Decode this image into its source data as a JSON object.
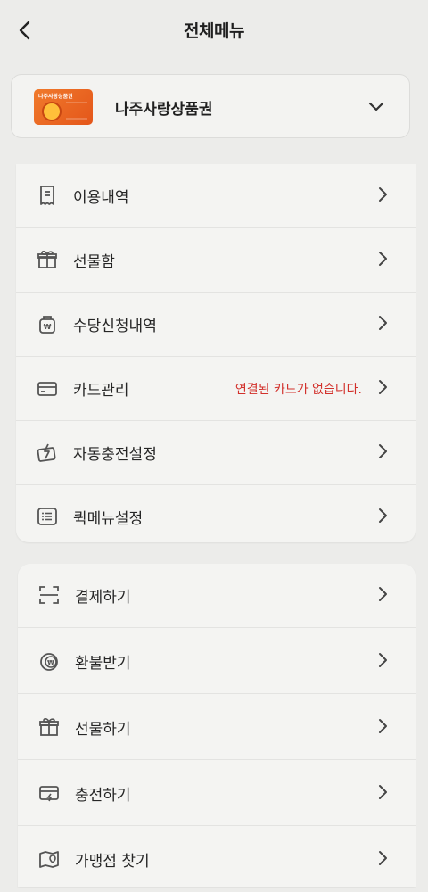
{
  "header": {
    "title": "전체메뉴"
  },
  "voucher": {
    "name": "나주사랑상품권",
    "image_text": "나주사랑상품권"
  },
  "menu_group_1": [
    {
      "label": "이용내역",
      "icon": "receipt-icon"
    },
    {
      "label": "선물함",
      "icon": "gift-box-icon"
    },
    {
      "label": "수당신청내역",
      "icon": "won-bag-icon"
    },
    {
      "label": "카드관리",
      "icon": "card-icon",
      "note": "연결된 카드가 없습니다."
    },
    {
      "label": "자동충전설정",
      "icon": "auto-charge-icon"
    },
    {
      "label": "퀵메뉴설정",
      "icon": "list-icon"
    }
  ],
  "menu_group_2": [
    {
      "label": "결제하기",
      "icon": "scan-icon"
    },
    {
      "label": "환불받기",
      "icon": "refund-icon"
    },
    {
      "label": "선물하기",
      "icon": "gift-icon"
    },
    {
      "label": "충전하기",
      "icon": "charge-card-icon"
    },
    {
      "label": "가맹점 찾기",
      "icon": "map-pin-icon"
    }
  ],
  "colors": {
    "note": "#d2302b",
    "voucher_accent": "#f07a2c"
  }
}
